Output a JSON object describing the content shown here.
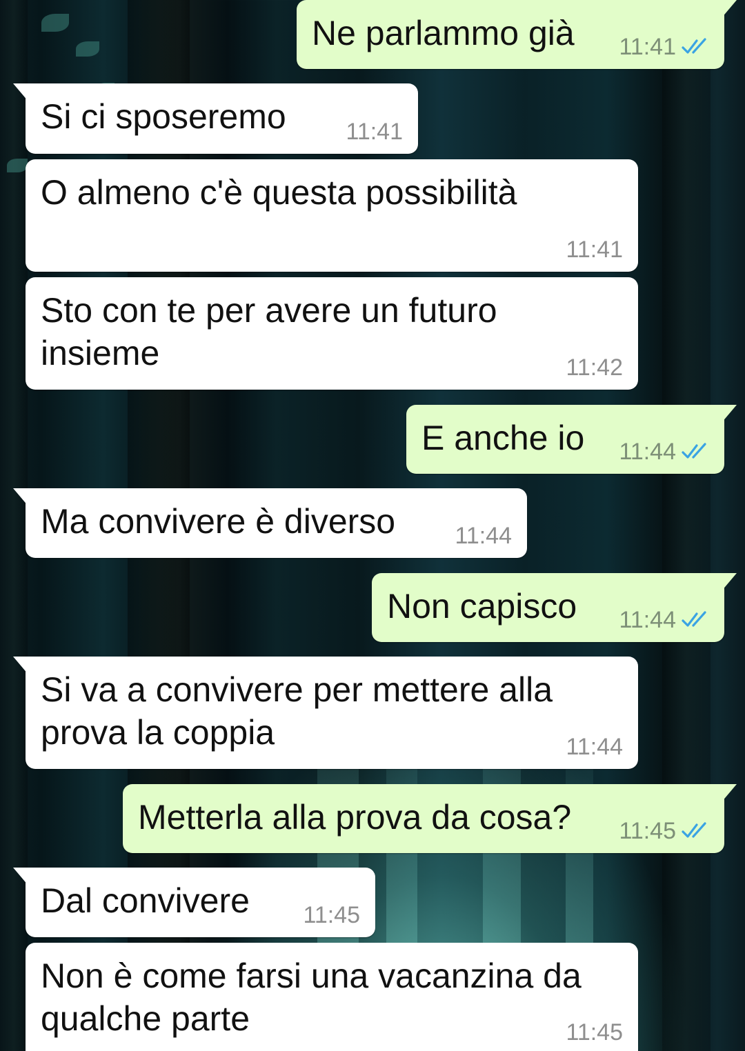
{
  "chat": {
    "messages": [
      {
        "id": "m1",
        "direction": "out",
        "text": "Ne parlammo già",
        "time": "11:41",
        "status": "read-ticks-icon"
      },
      {
        "id": "m2",
        "direction": "in",
        "text": "Si ci sposeremo",
        "time": "11:41"
      },
      {
        "id": "m3",
        "direction": "in",
        "text": "O almeno c'è questa possibilità",
        "time": "11:41"
      },
      {
        "id": "m4",
        "direction": "in",
        "text": "Sto con te per avere un futuro\ninsieme",
        "time": "11:42"
      },
      {
        "id": "m5",
        "direction": "out",
        "text": "E anche io",
        "time": "11:44",
        "status": "read-ticks-icon"
      },
      {
        "id": "m6",
        "direction": "in",
        "text": "Ma convivere è diverso",
        "time": "11:44"
      },
      {
        "id": "m7",
        "direction": "out",
        "text": "Non capisco",
        "time": "11:44",
        "status": "read-ticks-icon"
      },
      {
        "id": "m8",
        "direction": "in",
        "text": "Si va a convivere per mettere alla\nprova la coppia",
        "time": "11:44"
      },
      {
        "id": "m9",
        "direction": "out",
        "text": "Metterla alla prova da cosa?",
        "time": "11:45",
        "status": "read-ticks-icon"
      },
      {
        "id": "m10",
        "direction": "in",
        "text": "Dal convivere",
        "time": "11:45"
      },
      {
        "id": "m11",
        "direction": "in",
        "text": "Non è come farsi una vacanzina da\nqualche parte",
        "time": "11:45"
      }
    ]
  },
  "colors": {
    "incoming_bubble": "#ffffff",
    "outgoing_bubble": "#e2fdc9",
    "read_ticks": "#3aa3e3",
    "timestamp": "#8e8e8e"
  }
}
